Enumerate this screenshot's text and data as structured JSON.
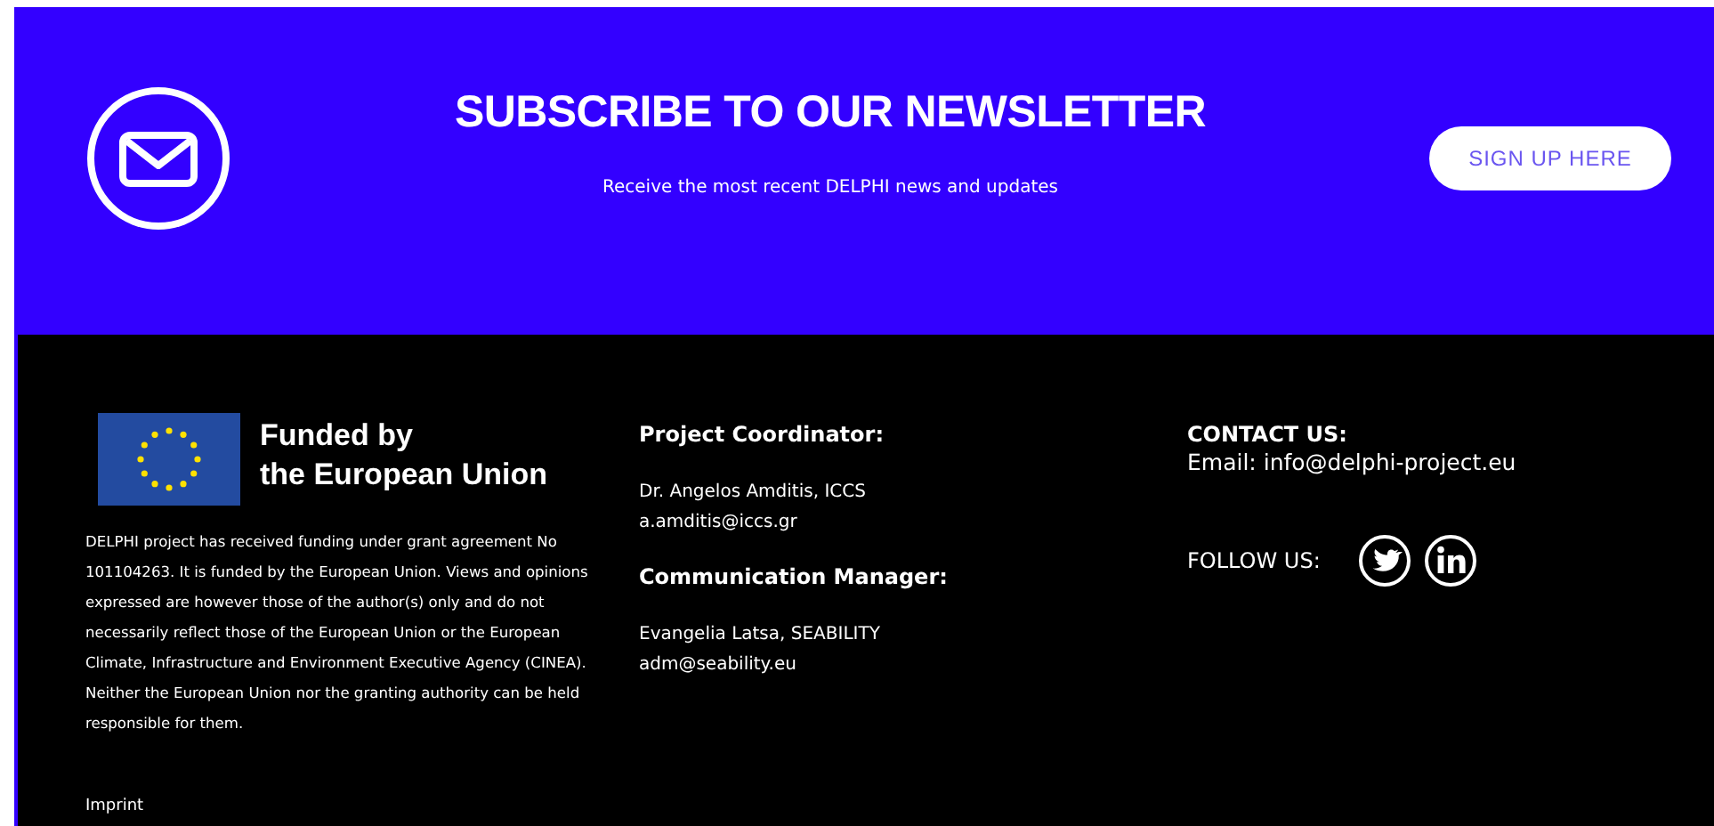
{
  "newsletter": {
    "title": "SUBSCRIBE TO OUR NEWSLETTER",
    "subtitle": "Receive the most recent DELPHI news and updates",
    "button": "SIGN UP HERE"
  },
  "funding": {
    "logo_line_1": "Funded by",
    "logo_line_2": "the European Union",
    "disclaimer": "DELPHI project has received funding under grant agreement No 101104263. It is funded by the European Union. Views and opinions expressed are however those of the author(s) only and do not necessarily reflect those of the European Union or the European Climate, Infrastructure and Environment Executive Agency (CINEA). Neither the European Union nor the granting authority can be held responsible for them.",
    "link": "Imprint"
  },
  "contacts": [
    {
      "heading": "Project Coordinator:",
      "name": "Dr. Angelos Amditis, ICCS",
      "email": "a.amditis@iccs.gr"
    },
    {
      "heading": "Communication Manager:",
      "name": "Evangelia Latsa, SEABILITY",
      "email": "adm@seability.eu"
    }
  ],
  "contact_us": {
    "heading": "CONTACT US:",
    "email": "Email: info@delphi-project.eu",
    "follow_label": "FOLLOW US:"
  }
}
